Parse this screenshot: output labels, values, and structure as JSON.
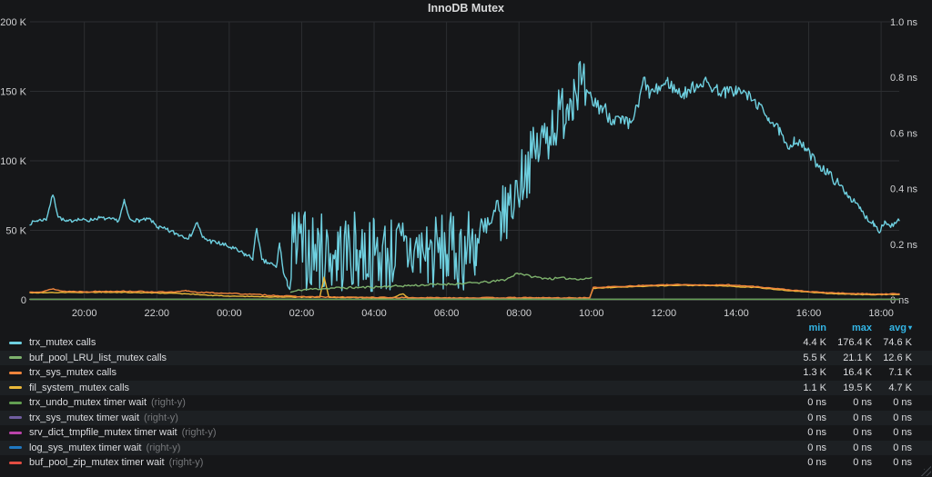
{
  "panel": {
    "title": "InnoDB Mutex"
  },
  "colors": {
    "background": "#161719",
    "grid": "#2c2e31",
    "axis_text": "#d0d1d3",
    "header_blue": "#33b5e5",
    "legend_text": "#dcdde0",
    "legend_dim": "#75777a",
    "row_alt_bg": "#1d2023"
  },
  "chart_data": {
    "type": "line",
    "title": "InnoDB Mutex",
    "x_axis": {
      "span_hours": 24,
      "ticks": [
        {
          "t": 1.5,
          "label": "20:00"
        },
        {
          "t": 3.5,
          "label": "22:00"
        },
        {
          "t": 5.5,
          "label": "00:00"
        },
        {
          "t": 7.5,
          "label": "02:00"
        },
        {
          "t": 9.5,
          "label": "04:00"
        },
        {
          "t": 11.5,
          "label": "06:00"
        },
        {
          "t": 13.5,
          "label": "08:00"
        },
        {
          "t": 15.5,
          "label": "10:00"
        },
        {
          "t": 17.5,
          "label": "12:00"
        },
        {
          "t": 19.5,
          "label": "14:00"
        },
        {
          "t": 21.5,
          "label": "16:00"
        },
        {
          "t": 23.5,
          "label": "18:00"
        }
      ]
    },
    "left_axis": {
      "unit": "K calls",
      "max": 200,
      "ticks": [
        {
          "v": 0,
          "label": "0"
        },
        {
          "v": 50,
          "label": "50 K"
        },
        {
          "v": 100,
          "label": "100 K"
        },
        {
          "v": 150,
          "label": "150 K"
        },
        {
          "v": 200,
          "label": "200 K"
        }
      ]
    },
    "right_axis": {
      "unit": "ns",
      "max": 1,
      "ticks": [
        {
          "v": 0,
          "label": "0 ns"
        },
        {
          "v": 0.2,
          "label": "0.2 ns"
        },
        {
          "v": 0.4,
          "label": "0.4 ns"
        },
        {
          "v": 0.6,
          "label": "0.6 ns"
        },
        {
          "v": 0.8,
          "label": "0.8 ns"
        },
        {
          "v": 1.0,
          "label": "1.0 ns"
        }
      ]
    },
    "series": [
      {
        "name": "trx_mutex calls",
        "color": "#6ED0E0",
        "axis": "left",
        "width": 1.4,
        "step": 0.035,
        "seed": 7,
        "keypoints": [
          [
            0,
            55
          ],
          [
            0.2,
            57
          ],
          [
            0.45,
            58
          ],
          [
            0.63,
            76
          ],
          [
            0.78,
            60
          ],
          [
            1,
            56
          ],
          [
            1.3,
            58
          ],
          [
            1.6,
            57
          ],
          [
            1.9,
            59
          ],
          [
            2.2,
            58
          ],
          [
            2.45,
            57
          ],
          [
            2.6,
            71
          ],
          [
            2.75,
            58
          ],
          [
            3,
            57
          ],
          [
            3.3,
            58
          ],
          [
            3.55,
            52
          ],
          [
            3.8,
            50
          ],
          [
            4.1,
            47
          ],
          [
            4.4,
            45
          ],
          [
            4.62,
            56
          ],
          [
            4.75,
            45
          ],
          [
            5,
            42
          ],
          [
            5.3,
            40
          ],
          [
            5.6,
            37
          ],
          [
            5.9,
            33
          ],
          [
            6.15,
            30
          ],
          [
            6.26,
            52
          ],
          [
            6.4,
            28
          ],
          [
            6.65,
            26
          ],
          [
            6.8,
            23
          ],
          [
            6.89,
            41
          ],
          [
            7,
            19
          ],
          [
            7.1,
            12
          ],
          [
            7.18,
            8
          ],
          [
            7.25,
            40
          ],
          [
            7.6,
            36
          ],
          [
            8,
            34
          ],
          [
            8.5,
            33
          ],
          [
            9,
            35
          ],
          [
            9.5,
            33
          ],
          [
            10,
            33
          ],
          [
            10.5,
            35
          ],
          [
            11,
            34
          ],
          [
            11.5,
            33
          ],
          [
            12,
            36
          ],
          [
            12.3,
            41
          ],
          [
            12.6,
            47
          ],
          [
            13,
            58
          ],
          [
            13.3,
            70
          ],
          [
            13.6,
            90
          ],
          [
            14,
            108
          ],
          [
            14.3,
            120
          ],
          [
            14.6,
            132
          ],
          [
            14.8,
            140
          ],
          [
            15,
            152
          ],
          [
            15.15,
            158
          ],
          [
            15.3,
            148
          ],
          [
            15.5,
            143
          ],
          [
            15.8,
            138
          ],
          [
            16,
            133
          ],
          [
            16.3,
            127
          ],
          [
            16.55,
            125
          ],
          [
            16.8,
            140
          ],
          [
            16.95,
            159
          ],
          [
            17.1,
            148
          ],
          [
            17.3,
            151
          ],
          [
            17.6,
            157
          ],
          [
            17.85,
            150
          ],
          [
            18.05,
            148
          ],
          [
            18.3,
            153
          ],
          [
            18.6,
            157
          ],
          [
            18.9,
            152
          ],
          [
            19.2,
            149
          ],
          [
            19.5,
            151
          ],
          [
            19.8,
            147
          ],
          [
            20.1,
            140
          ],
          [
            20.4,
            131
          ],
          [
            20.7,
            121
          ],
          [
            20.9,
            109
          ],
          [
            21.1,
            115
          ],
          [
            21.4,
            109
          ],
          [
            21.7,
            99
          ],
          [
            22,
            92
          ],
          [
            22.3,
            84
          ],
          [
            22.6,
            75
          ],
          [
            22.9,
            66
          ],
          [
            23.1,
            59
          ],
          [
            23.3,
            55
          ],
          [
            23.45,
            50
          ],
          [
            23.6,
            56
          ],
          [
            23.8,
            53
          ],
          [
            24,
            57
          ]
        ],
        "noise": [
          [
            0,
            3.4,
            2.5
          ],
          [
            3.4,
            7.18,
            3.5
          ],
          [
            7.18,
            12.3,
            58
          ],
          [
            12.3,
            15.35,
            44
          ],
          [
            15.35,
            16.6,
            13
          ],
          [
            16.6,
            20,
            9
          ],
          [
            20,
            22.5,
            7
          ],
          [
            22.5,
            24,
            4.5
          ]
        ]
      },
      {
        "name": "fil_system_mutex calls",
        "color": "#EAB839",
        "axis": "left",
        "width": 1.4,
        "step": 0.06,
        "seed": 17,
        "keypoints": [
          [
            0,
            5.1
          ],
          [
            1,
            5.3
          ],
          [
            2,
            5.5
          ],
          [
            3,
            5.2
          ],
          [
            4,
            4.7
          ],
          [
            4.5,
            4.1
          ],
          [
            5,
            3.2
          ],
          [
            5.5,
            2.7
          ],
          [
            6,
            2.4
          ],
          [
            6.5,
            2.2
          ],
          [
            7,
            2.1
          ],
          [
            7.5,
            2
          ],
          [
            8,
            1.9
          ],
          [
            8.12,
            16
          ],
          [
            8.25,
            1.9
          ],
          [
            9,
            1.7
          ],
          [
            9.5,
            1.5
          ],
          [
            10,
            1.4
          ],
          [
            10.3,
            4.5
          ],
          [
            10.45,
            1.3
          ],
          [
            11,
            1.2
          ],
          [
            11.5,
            1.2
          ],
          [
            12,
            1.1
          ],
          [
            13,
            1.1
          ],
          [
            14,
            1.2
          ],
          [
            15,
            1.2
          ],
          [
            15.45,
            1.3
          ],
          [
            15.55,
            8.2
          ],
          [
            16,
            8.8
          ],
          [
            17,
            9.8
          ],
          [
            18,
            10.4
          ],
          [
            19,
            10.1
          ],
          [
            20,
            9
          ],
          [
            21,
            6.5
          ],
          [
            22,
            4.6
          ],
          [
            23,
            3.7
          ],
          [
            24,
            3.8
          ]
        ],
        "noise": [
          [
            0,
            24,
            0.5
          ]
        ]
      },
      {
        "name": "trx_sys_mutex calls",
        "color": "#EF843C",
        "axis": "left",
        "width": 1.4,
        "step": 0.06,
        "seed": 13,
        "keypoints": [
          [
            0,
            5.6
          ],
          [
            0.3,
            5.9
          ],
          [
            0.65,
            7.8
          ],
          [
            0.9,
            6.2
          ],
          [
            1.5,
            5.9
          ],
          [
            2,
            6.1
          ],
          [
            2.5,
            6.3
          ],
          [
            3,
            6
          ],
          [
            3.5,
            5.7
          ],
          [
            4,
            5.5
          ],
          [
            4.3,
            6.6
          ],
          [
            4.6,
            5.5
          ],
          [
            5,
            5.1
          ],
          [
            5.5,
            4.7
          ],
          [
            6,
            4.1
          ],
          [
            6.5,
            3.5
          ],
          [
            7,
            2.8
          ],
          [
            7.5,
            2.3
          ],
          [
            8,
            2.1
          ],
          [
            8.5,
            1.9
          ],
          [
            9,
            1.8
          ],
          [
            9.5,
            1.7
          ],
          [
            10,
            1.6
          ],
          [
            11,
            1.5
          ],
          [
            12,
            1.5
          ],
          [
            13,
            1.5
          ],
          [
            14,
            1.5
          ],
          [
            15,
            1.4
          ],
          [
            15.45,
            1.5
          ],
          [
            15.55,
            8.8
          ],
          [
            16,
            9.4
          ],
          [
            16.5,
            9.9
          ],
          [
            17,
            10.4
          ],
          [
            17.5,
            10.7
          ],
          [
            18,
            11
          ],
          [
            18.5,
            10.8
          ],
          [
            19,
            10.6
          ],
          [
            19.3,
            10.9
          ],
          [
            19.6,
            10.2
          ],
          [
            20,
            9.6
          ],
          [
            20.3,
            8.9
          ],
          [
            20.6,
            8.1
          ],
          [
            21,
            7.1
          ],
          [
            21.3,
            6.4
          ],
          [
            21.6,
            5.7
          ],
          [
            22,
            5.2
          ],
          [
            22.4,
            4.8
          ],
          [
            22.8,
            4.5
          ],
          [
            23.2,
            4.3
          ],
          [
            23.6,
            4.2
          ],
          [
            24,
            4.4
          ]
        ],
        "noise": [
          [
            0,
            15.5,
            0.7
          ],
          [
            15.5,
            24,
            0.6
          ]
        ]
      },
      {
        "name": "buf_pool_LRU_list_mutex calls",
        "color": "#7EB26D",
        "axis": "left",
        "width": 1.4,
        "step": 0.05,
        "seed": 11,
        "keypoints": [
          [
            7.2,
            5.5
          ],
          [
            7.5,
            7.2
          ],
          [
            8,
            8
          ],
          [
            8.5,
            8.6
          ],
          [
            9,
            8.8
          ],
          [
            9.5,
            9.2
          ],
          [
            10,
            9.8
          ],
          [
            10.5,
            10.3
          ],
          [
            11,
            10.8
          ],
          [
            11.5,
            11.3
          ],
          [
            12,
            11.8
          ],
          [
            12.4,
            12.4
          ],
          [
            12.8,
            13.2
          ],
          [
            13.1,
            14.5
          ],
          [
            13.3,
            16.5
          ],
          [
            13.45,
            19.5
          ],
          [
            13.6,
            18.5
          ],
          [
            13.8,
            17
          ],
          [
            14.1,
            15.8
          ],
          [
            14.4,
            15.2
          ],
          [
            14.7,
            15.6
          ],
          [
            15,
            15.2
          ],
          [
            15.3,
            15
          ],
          [
            15.5,
            16
          ]
        ],
        "noise": [
          [
            7.2,
            15.5,
            1.6
          ]
        ]
      },
      {
        "name": "buf_pool_zip_mutex timer wait",
        "color": "#E24D42",
        "axis": "right",
        "width": 1.5,
        "step": 12,
        "seed": 1,
        "keypoints": [
          [
            0,
            0.002
          ],
          [
            24,
            0.002
          ]
        ],
        "noise": []
      },
      {
        "name": "log_sys_mutex timer wait",
        "color": "#1F78C1",
        "axis": "right",
        "width": 1.5,
        "step": 12,
        "seed": 1,
        "keypoints": [
          [
            0,
            0.002
          ],
          [
            24,
            0.002
          ]
        ],
        "noise": []
      },
      {
        "name": "srv_dict_tmpfile_mutex timer wait",
        "color": "#BA43A9",
        "axis": "right",
        "width": 1.5,
        "step": 12,
        "seed": 1,
        "keypoints": [
          [
            0,
            0.002
          ],
          [
            24,
            0.002
          ]
        ],
        "noise": []
      },
      {
        "name": "trx_sys_mutex timer wait",
        "color": "#705DA0",
        "axis": "right",
        "width": 1.5,
        "step": 12,
        "seed": 1,
        "keypoints": [
          [
            0,
            0.002
          ],
          [
            24,
            0.002
          ]
        ],
        "noise": []
      },
      {
        "name": "trx_undo_mutex timer wait",
        "color": "#629E51",
        "axis": "right",
        "width": 1.6,
        "step": 12,
        "seed": 1,
        "keypoints": [
          [
            0,
            0.002
          ],
          [
            24,
            0.002
          ]
        ],
        "noise": []
      }
    ]
  },
  "legend": {
    "columns": {
      "min": "min",
      "max": "max",
      "avg": "avg"
    },
    "sorted_by": "avg",
    "rows": [
      {
        "label": "trx_mutex calls",
        "suffix": "",
        "color": "#6ED0E0",
        "min": "4.4 K",
        "max": "176.4 K",
        "avg": "74.6 K"
      },
      {
        "label": "buf_pool_LRU_list_mutex calls",
        "suffix": "",
        "color": "#7EB26D",
        "min": "5.5 K",
        "max": "21.1 K",
        "avg": "12.6 K"
      },
      {
        "label": "trx_sys_mutex calls",
        "suffix": "",
        "color": "#EF843C",
        "min": "1.3 K",
        "max": "16.4 K",
        "avg": "7.1 K"
      },
      {
        "label": "fil_system_mutex calls",
        "suffix": "",
        "color": "#EAB839",
        "min": "1.1 K",
        "max": "19.5 K",
        "avg": "4.7 K"
      },
      {
        "label": "trx_undo_mutex timer wait",
        "suffix": "(right-y)",
        "color": "#629E51",
        "min": "0 ns",
        "max": "0 ns",
        "avg": "0 ns"
      },
      {
        "label": "trx_sys_mutex timer wait",
        "suffix": "(right-y)",
        "color": "#705DA0",
        "min": "0 ns",
        "max": "0 ns",
        "avg": "0 ns"
      },
      {
        "label": "srv_dict_tmpfile_mutex timer wait",
        "suffix": "(right-y)",
        "color": "#BA43A9",
        "min": "0 ns",
        "max": "0 ns",
        "avg": "0 ns"
      },
      {
        "label": "log_sys_mutex timer wait",
        "suffix": "(right-y)",
        "color": "#1F78C1",
        "min": "0 ns",
        "max": "0 ns",
        "avg": "0 ns"
      },
      {
        "label": "buf_pool_zip_mutex timer wait",
        "suffix": "(right-y)",
        "color": "#E24D42",
        "min": "0 ns",
        "max": "0 ns",
        "avg": "0 ns"
      }
    ]
  }
}
